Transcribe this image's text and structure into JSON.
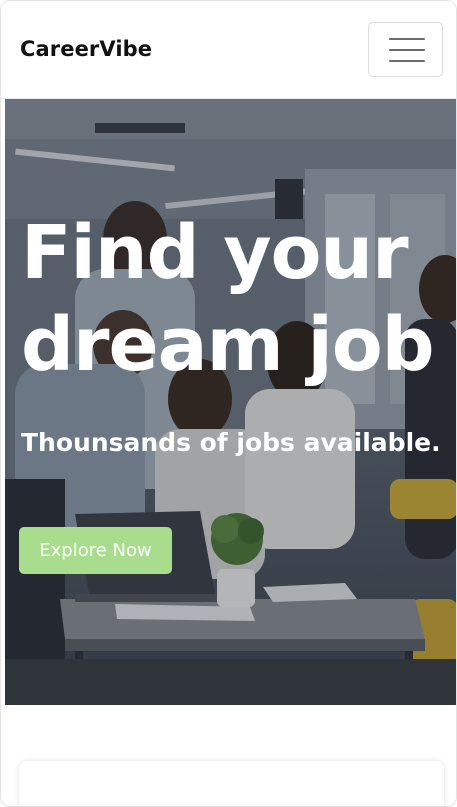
{
  "navbar": {
    "brand": "CareerVibe",
    "toggle_icon": "hamburger-menu-icon"
  },
  "hero": {
    "title": "Find your dream job",
    "subtitle": "Thounsands of jobs available.",
    "cta_label": "Explore Now",
    "image": "office-team-meeting-photo"
  },
  "colors": {
    "cta_background": "#a7dd8c",
    "brand_text": "#111111",
    "hero_text": "#ffffff"
  }
}
